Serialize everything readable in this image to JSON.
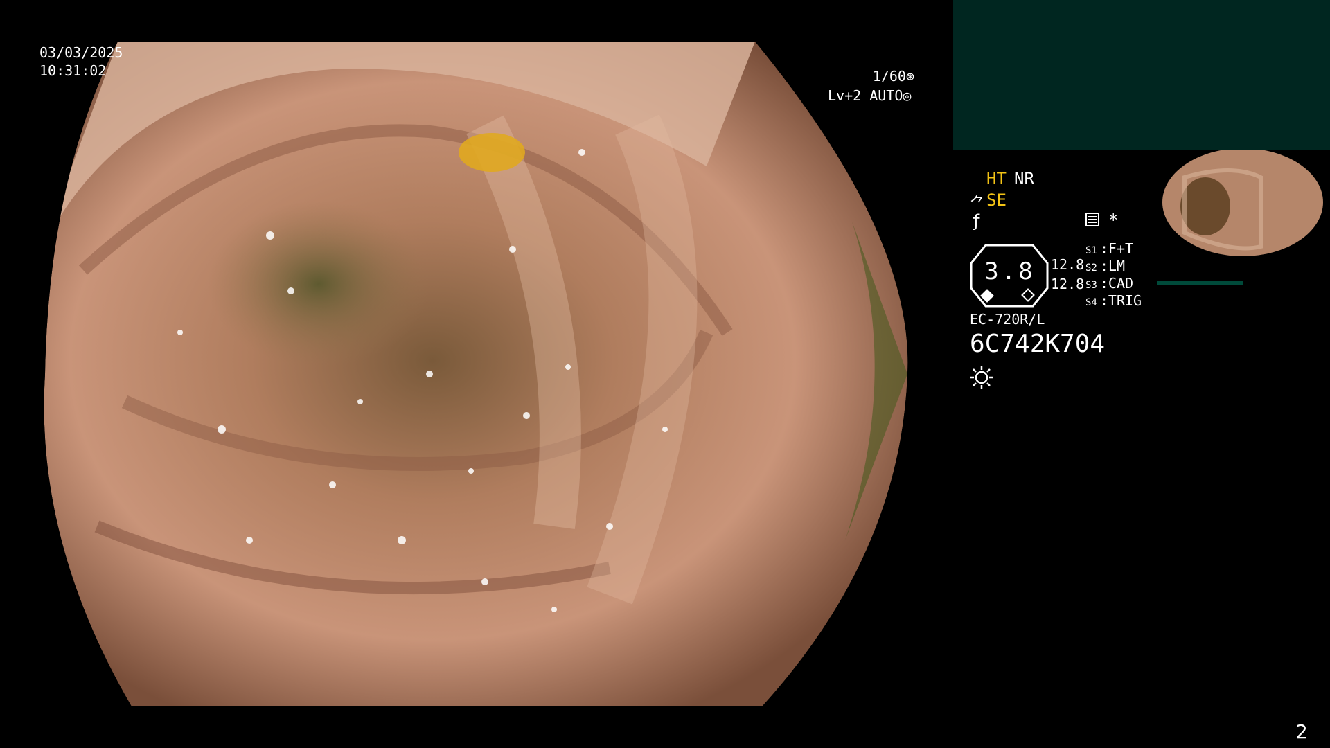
{
  "main_view": {
    "date": "03/03/2025",
    "time": "10:31:02",
    "shutter": "1/60",
    "level": "Lv+2 AUTO",
    "shutter_icon": "aperture-icon",
    "auto_icon": "iris-icon"
  },
  "status": {
    "ht": "HT",
    "nr": "NR",
    "se": "SE",
    "se_icon": "scope-tip-icon",
    "f_icon": "freeze-icon",
    "doc_icon": "document-icon",
    "asterisk": "*"
  },
  "gauge": {
    "value": "3.8",
    "val1": "12.8",
    "val2": "12.8"
  },
  "switches": [
    {
      "key": "S1",
      "label": "F+T"
    },
    {
      "key": "S2",
      "label": "LM"
    },
    {
      "key": "S3",
      "label": "CAD"
    },
    {
      "key": "S4",
      "label": "TRIG"
    }
  ],
  "scope": {
    "model": "EC-720R/L",
    "serial": "6C742K704",
    "light_icon": "light-source-icon"
  },
  "page_number": "2",
  "colors": {
    "panel_bg": "#002620",
    "accent_yellow": "#f3c315"
  }
}
